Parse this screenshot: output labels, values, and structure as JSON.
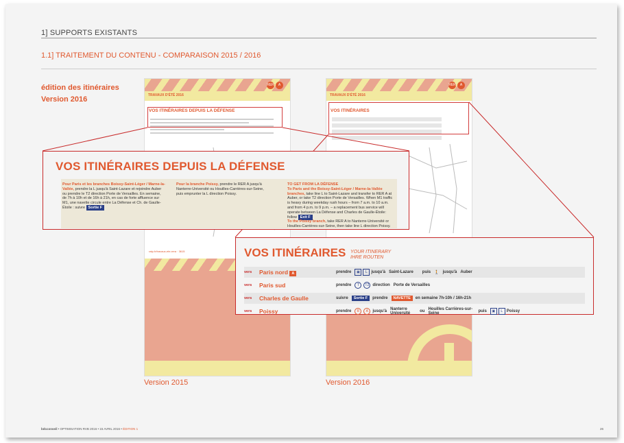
{
  "header": {
    "title": "1] SUPPORTS EXISTANTS"
  },
  "subheader": {
    "title": "1.1] TRAITEMENT DU CONTENU - COMPARAISON 2015 / 2016"
  },
  "edition_label": {
    "line1": "édition des itinéraires",
    "line2": "Version 2016"
  },
  "doc2015": {
    "band": "TRAVAUX D'ÉTÉ 2016",
    "mini_title": "VOS ITINÉRAIRES DEPUIS LA DÉFENSE",
    "url": "ratp.fr/travaux-ete-rera · 3615",
    "version_label": "Version 2015"
  },
  "doc2016": {
    "band": "TRAVAUX D'ÉTÉ 2016",
    "mini_title": "VOS ITINÉRAIRES",
    "version_label": "Version 2016"
  },
  "callout1": {
    "title": "VOS ITINÉRAIRES DEPUIS LA DÉFENSE",
    "col1_lead": "Pour Paris et les branches Boissy-Saint-Léger / Marne-la-Vallée,",
    "col1_text": "prendre la L jusqu'à Saint-Lazare et rejoindre Auber ou prendre le T2 direction Porte de Versailles. En semaine, de 7h à 10h et de 16h à 21h, en cas de forte affluence sur M1, une navette circule entre La Défense et Ch. de Gaulle-Étoile : suivre",
    "col1_chip": "Sortie F",
    "col2_lead": "Pour la branche Poissy,",
    "col2_text": "prendre le RER A jusqu'à Nanterre-Université ou Houilles-Carrières-sur-Seine, puis emprunter la L direction Poissy.",
    "col3_lead": "TO GET FROM LA DÉFENSE",
    "col3_lead2": "To Paris and the Boissy-Saint-Léger / Marne-la-Vallée branches,",
    "col3_text": "take line L to Saint-Lazare and transfer to RER A at Auber, or take T2 direction Porte de Versailles. When M1 traffic is heavy during weekday rush hours – from 7 a.m. to 10 a.m. and from 4 p.m. to 9 p.m. – a replacement bus service will operate between La Défense and Charles de Gaulle-Étoile: follow",
    "col3_chip": "Exit F",
    "col3_lead3": "To the Poissy branch,",
    "col3_text2": "take RER A to Nanterre-Université or Houilles-Carrières-sur-Seine, then take line L direction Poissy."
  },
  "callout2": {
    "title": "VOS ITINÉRAIRES",
    "sub1": "YOUR ITINERARY",
    "sub2": "IHRE ROUTEN",
    "vers": "vers",
    "routes": [
      {
        "dest": "Paris nord",
        "prendre": "prendre",
        "l": "L",
        "jusqua": "jusqu'à",
        "to": "Saint-Lazare",
        "puis": "puis",
        "jusqua2": "jusqu'à",
        "to2": "Auber"
      },
      {
        "dest": "Paris sud",
        "prendre": "prendre",
        "t": "T2",
        "direction": "direction",
        "to": "Porte de Versailles"
      },
      {
        "dest": "Charles de Gaulle",
        "suivre": "suivre",
        "chip": "Sortie F",
        "prendre": "prendre",
        "navette": "NAVETTE",
        "hours": "en semaine 7h-10h / 16h-21h"
      },
      {
        "dest": "Poissy",
        "prendre": "prendre",
        "a": "A",
        "jusqua": "jusqu'à",
        "to": "Nanterre Université",
        "ou": "ou",
        "to2": "Houilles Carrières-sur-Seine",
        "puis": "puis",
        "l": "L",
        "to3": "Poissy"
      }
    ]
  },
  "footer": {
    "brand": "bdcconseil",
    "text": " • OPTIMISATION RVB 2016 • 15 AVRIL 2016 • ",
    "edition": "ÉDITION 1",
    "page": "26"
  },
  "colors": {
    "accent": "#e0592f",
    "salmon": "#e9a590",
    "yellow": "#f2e9a0",
    "callout_border": "#c82a2a"
  }
}
